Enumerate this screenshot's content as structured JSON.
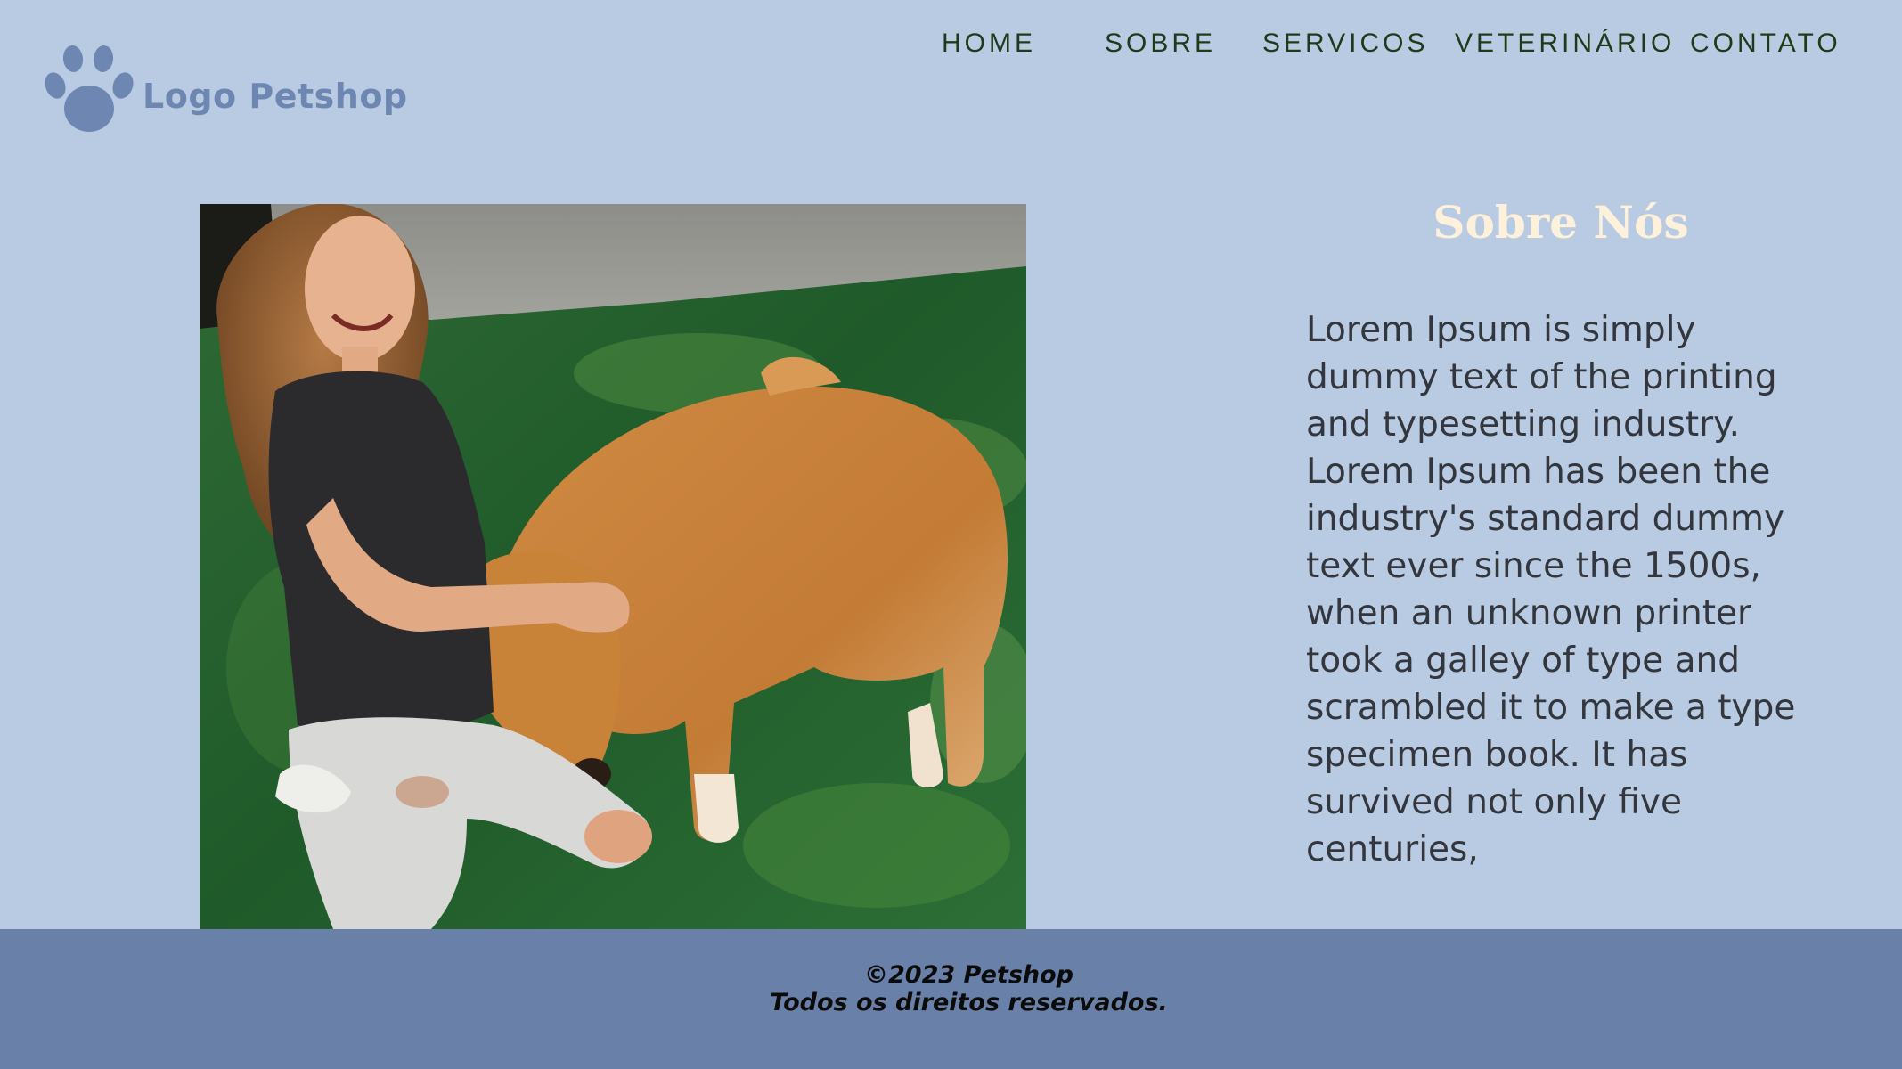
{
  "header": {
    "logo_text": "Logo Petshop",
    "logo_icon": "paw-icon"
  },
  "nav": {
    "items": [
      {
        "label": "HOME"
      },
      {
        "label": "SOBRE"
      },
      {
        "label": "SERVICOS"
      },
      {
        "label": "VETERINÁRIO"
      },
      {
        "label": "CONTATO"
      }
    ]
  },
  "about": {
    "title": "Sobre Nós",
    "body": "Lorem Ipsum is simply dummy text of the printing and typesetting industry. Lorem Ipsum has been the industry's standard dummy text ever since the 1500s, when an unknown printer took a galley of type and scrambled it to make a type specimen book. It has survived not only five centuries,"
  },
  "footer": {
    "copyright": "©2023 Petshop",
    "rights": "Todos os direitos reservados."
  },
  "colors": {
    "background": "#b9cbe3",
    "footer": "#6980a8",
    "logo": "#6e87b2",
    "nav_text": "#1f3a1a",
    "title": "#fdf1dc",
    "body_text": "#33363d"
  }
}
